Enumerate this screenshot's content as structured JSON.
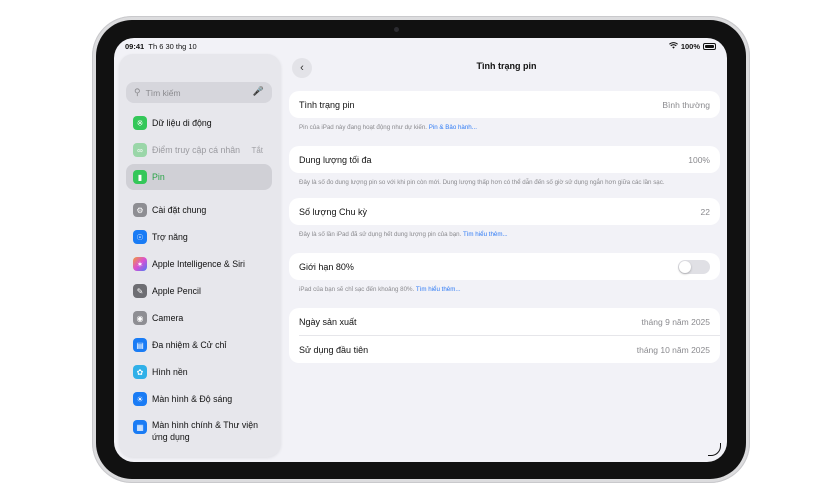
{
  "status": {
    "time": "09:41",
    "date": "Th 6 30 thg 10",
    "battery": "100%"
  },
  "search": {
    "placeholder": "Tìm kiếm"
  },
  "sidebar": {
    "items": [
      {
        "label": "Dữ liệu di động",
        "icon": "antenna-icon",
        "color": "#34c759"
      },
      {
        "label": "Điểm truy cập cá nhân",
        "trail": "Tắt",
        "icon": "link-icon",
        "color": "#9ad6a8"
      },
      {
        "label": "Pin",
        "icon": "battery-icon",
        "color": "#34c759"
      },
      {
        "label": "Cài đặt chung",
        "icon": "gear-icon",
        "color": "#8e8e93"
      },
      {
        "label": "Trợ năng",
        "icon": "accessibility-icon",
        "color": "#1a7cf5"
      },
      {
        "label": "Apple Intelligence & Siri",
        "icon": "siri-icon",
        "color": "#d94fd3"
      },
      {
        "label": "Apple Pencil",
        "icon": "pencil-icon",
        "color": "#6e6e73"
      },
      {
        "label": "Camera",
        "icon": "camera-icon",
        "color": "#8e8e93"
      },
      {
        "label": "Đa nhiệm & Cử chỉ",
        "icon": "multitask-icon",
        "color": "#1a7cf5"
      },
      {
        "label": "Hình nền",
        "icon": "flower-icon",
        "color": "#30b0e8"
      },
      {
        "label": "Màn hình & Độ sáng",
        "icon": "sun-icon",
        "color": "#1a7cf5"
      },
      {
        "label": "Màn hình chính & Thư viện ứng dụng",
        "icon": "homescreen-icon",
        "color": "#1a7cf5"
      }
    ]
  },
  "detail": {
    "title": "Tình trạng pin",
    "health": {
      "label": "Tình trạng pin",
      "value": "Bình thường",
      "note": "Pin của iPad này đang hoạt động như dự kiến.",
      "note_link": "Pin & Bảo hành..."
    },
    "capacity": {
      "label": "Dung lượng tối đa",
      "value": "100%",
      "note": "Đây là số đo dung lượng pin so với khi pin còn mới. Dung lượng thấp hơn có thể dẫn đến số giờ sử dụng ngắn hơn giữa các lần sạc."
    },
    "cycles": {
      "label": "Số lượng Chu kỳ",
      "value": "22",
      "note": "Đây là số lần iPad đã sử dụng hết dung lượng pin của bạn.",
      "note_link": "Tìm hiểu thêm..."
    },
    "limit": {
      "label": "Giới hạn 80%",
      "enabled": false,
      "note": "iPad của bạn sẽ chỉ sạc đến khoảng 80%.",
      "note_link": "Tìm hiểu thêm..."
    },
    "dates": {
      "manufacture_label": "Ngày sản xuất",
      "manufacture_value": "tháng 9 năm 2025",
      "first_use_label": "Sử dụng đầu tiên",
      "first_use_value": "tháng 10 năm 2025"
    }
  }
}
